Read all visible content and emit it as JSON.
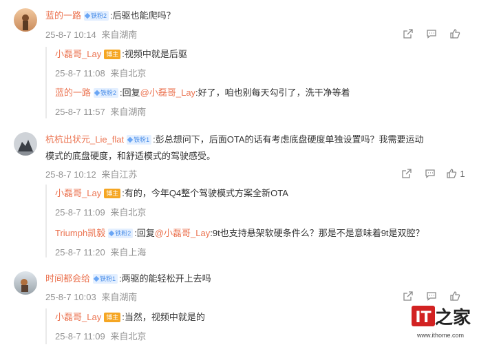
{
  "comments": [
    {
      "user": "蓝的一路",
      "badge": "铁粉2",
      "text": ":后驱也能爬吗？",
      "date": "25-8-7 10:14",
      "location": "来自湖南",
      "likes": "",
      "replies": [
        {
          "user": "小磊哥_Lay",
          "badge": "博主",
          "prefix": "",
          "mention": "",
          "text": ":视频中就是后驱",
          "date": "25-8-7 11:08",
          "location": "来自北京"
        },
        {
          "user": "蓝的一路",
          "badge": "铁粉2",
          "prefix": ":回复",
          "mention": "@小磊哥_Lay",
          "text": ":好了，咱也别每天勾引了，洗干净等着",
          "date": "25-8-7 11:57",
          "location": "来自湖南"
        }
      ]
    },
    {
      "user": "杭杭出状元_Lie_flat",
      "badge": "铁粉1",
      "text_line1": ":彭总想问下，后面OTA的话有考虑底盘硬度单独设置吗？我需要运动",
      "text_line2": "模式的底盘硬度，和舒适模式的驾驶感受。",
      "date": "25-8-7 10:12",
      "location": "来自江苏",
      "likes": "1",
      "replies": [
        {
          "user": "小磊哥_Lay",
          "badge": "博主",
          "prefix": "",
          "mention": "",
          "text": ":有的，今年Q4整个驾驶模式方案全新OTA",
          "date": "25-8-7 11:09",
          "location": "来自北京"
        },
        {
          "user": "Triumph凯毅",
          "badge": "铁粉2",
          "prefix": ":回复",
          "mention": "@小磊哥_Lay",
          "text": ":9t也支持悬架软硬条件么？那是不是意味着9t是双腔？",
          "date": "25-8-7 11:20",
          "location": "来自上海"
        }
      ]
    },
    {
      "user": "时间都会给",
      "badge": "铁粉1",
      "text": ":两驱的能轻松开上去吗",
      "date": "25-8-7 10:03",
      "location": "来自湖南",
      "likes": "",
      "replies": [
        {
          "user": "小磊哥_Lay",
          "badge": "博主",
          "prefix": "",
          "mention": "",
          "text": ":当然，视频中就是的",
          "date": "25-8-7 11:09",
          "location": "来自北京"
        }
      ]
    }
  ],
  "icons": {
    "share": "share-icon",
    "comment": "comment-icon",
    "like": "like-icon"
  },
  "watermark": {
    "logo": "IT之家",
    "url": "www.ithome.com"
  },
  "colors": {
    "name": "#eb7350",
    "meta": "#939393",
    "badge_bg": "#e3efff",
    "badge_fg": "#4a8ee8",
    "host_bg": "#f5a623"
  }
}
